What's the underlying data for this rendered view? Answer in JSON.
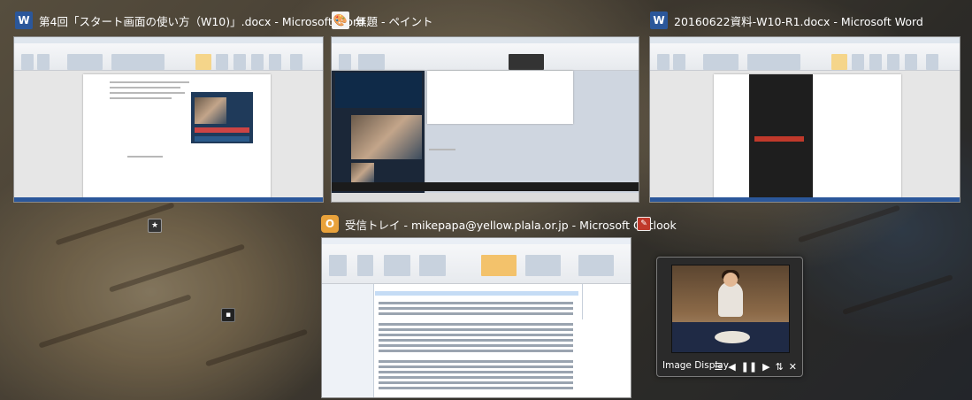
{
  "windows": [
    {
      "title": "第4回「スタート画面の使い方（W10)」.docx - Microsoft Word",
      "app_icon": "word-icon",
      "icon_glyph": "W"
    },
    {
      "title": "無題 - ペイント",
      "app_icon": "paint-icon",
      "icon_glyph": "🎨"
    },
    {
      "title": "20160622資料-W10-R1.docx - Microsoft Word",
      "app_icon": "word-icon",
      "icon_glyph": "W"
    },
    {
      "title": "受信トレイ - mikepapa@yellow.plala.or.jp - Microsoft Outlook",
      "app_icon": "outlook-icon",
      "icon_glyph": "O"
    }
  ],
  "image_display": {
    "label": "Image Display",
    "controls": [
      "☰",
      "◀",
      "❚❚",
      "▶",
      "⇅",
      "✕"
    ]
  },
  "colors": {
    "word_blue": "#2b579a",
    "outlook_orange": "#e9a23b",
    "title_text": "#ffffff"
  }
}
